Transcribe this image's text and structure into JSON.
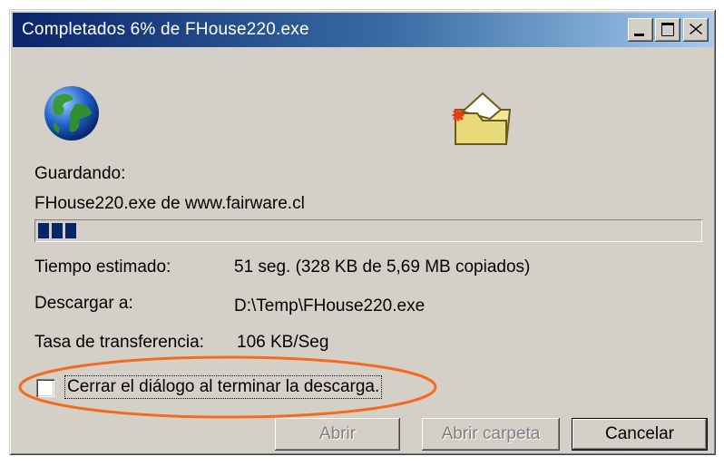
{
  "window": {
    "title": "Completados 6% de FHouse220.exe"
  },
  "icons": {
    "globe": "globe-icon",
    "folder": "folder-icon",
    "minimize": "minimize-icon",
    "maximize": "maximize-icon",
    "close": "close-icon"
  },
  "status": {
    "saving_label": "Guardando:",
    "file_source": "FHouse220.exe de www.fairware.cl",
    "progress_percent": 6
  },
  "details": {
    "time_label": "Tiempo estimado:",
    "time_value": "51 seg. (328 KB de 5,69 MB copiados)",
    "download_to_label": "Descargar a:",
    "download_to_value": "D:\\Temp\\FHouse220.exe",
    "transfer_rate_label": "Tasa de transferencia:",
    "transfer_rate_value": "106 KB/Seg"
  },
  "options": {
    "close_on_finish_label": "Cerrar el diálogo al terminar la descarga.",
    "close_on_finish_checked": false
  },
  "buttons": {
    "open": "Abrir",
    "open_folder": "Abrir carpeta",
    "cancel": "Cancelar"
  },
  "colors": {
    "titlebar_start": "#0a246a",
    "titlebar_end": "#a6caf0",
    "window_bg": "#d4d0c8",
    "progress_fill": "#0a246a",
    "highlight_ellipse": "#f26b21"
  }
}
